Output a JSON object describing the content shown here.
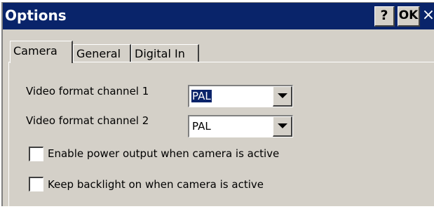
{
  "window": {
    "title": "Options",
    "help_label": "?",
    "ok_label": "OK",
    "close_label": "×"
  },
  "tabs": [
    {
      "label": "Camera",
      "active": true
    },
    {
      "label": "General",
      "active": false
    },
    {
      "label": "Digital In",
      "active": false
    }
  ],
  "camera": {
    "channel1": {
      "label": "Video format channel 1",
      "value": "PAL",
      "selected": true
    },
    "channel2": {
      "label": "Video format channel 2",
      "value": "PAL",
      "selected": false
    },
    "power_output": {
      "label": "Enable power output when camera is active",
      "checked": false
    },
    "backlight": {
      "label": "Keep backlight on when camera is active",
      "checked": false
    }
  },
  "colors": {
    "titlebar": "#09246a",
    "face": "#d4d0c8",
    "selection": "#0a246a"
  }
}
